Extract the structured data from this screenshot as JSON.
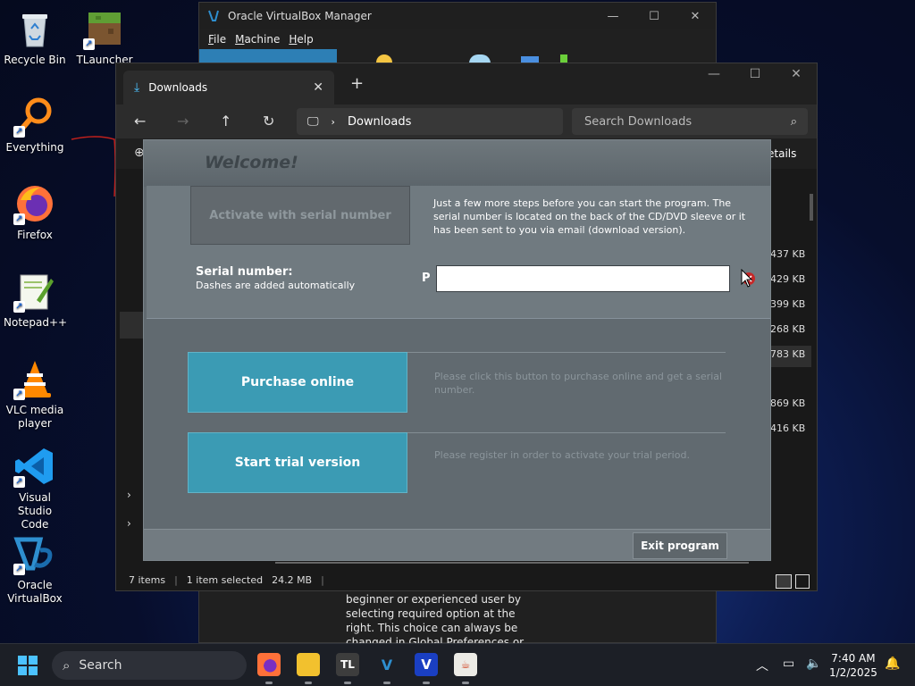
{
  "desktop": {
    "icons": [
      {
        "label": "Recycle Bin",
        "icon": "recycle-bin-icon"
      },
      {
        "label": "TLauncher",
        "icon": "tlauncher-icon"
      },
      {
        "label": "Everything",
        "icon": "everything-search-icon"
      },
      {
        "label": "Firefox",
        "icon": "firefox-icon"
      },
      {
        "label": "Notepad++",
        "icon": "notepad-plus-plus-icon"
      },
      {
        "label": "VLC media player",
        "icon": "vlc-icon"
      },
      {
        "label": "Visual Studio Code",
        "icon": "vscode-icon"
      },
      {
        "label": "Oracle VirtualBox",
        "icon": "virtualbox-icon"
      }
    ]
  },
  "vbox": {
    "title": "Oracle VirtualBox Manager",
    "menu": [
      "File",
      "Machine",
      "Help"
    ],
    "body_text": "beginner or experienced user by selecting required option at the right. This choice can always be changed in Global Preferences or Machine"
  },
  "explorer": {
    "tab_title": "Downloads",
    "breadcrumb": "Downloads",
    "search_placeholder": "Search Downloads",
    "details_label": "etails",
    "file_sizes": [
      "437 KB",
      "429 KB",
      "399 KB",
      "268 KB",
      "783 KB",
      "869 KB",
      "416 KB"
    ],
    "status": {
      "items": "7 items",
      "selected": "1 item selected",
      "size": "24.2 MB"
    }
  },
  "dialog": {
    "title": "Welcome!",
    "activate_label": "Activate with serial number",
    "activate_desc": "Just a few more steps before you can start the program. The serial number is located on the back of the CD/DVD sleeve or it has been sent to you via email (download version).",
    "serial_label": "Serial number:",
    "serial_sublabel": "Dashes are added automatically",
    "serial_prefix": "P",
    "serial_value": "",
    "purchase_label": "Purchase online",
    "purchase_desc": "Please click this button to purchase online and get a serial number.",
    "trial_label": "Start trial version",
    "trial_desc": "Please register in order to activate your trial period.",
    "exit_label": "Exit program"
  },
  "taskbar": {
    "search_label": "Search",
    "time": "7:40 AM",
    "date": "1/2/2025"
  }
}
